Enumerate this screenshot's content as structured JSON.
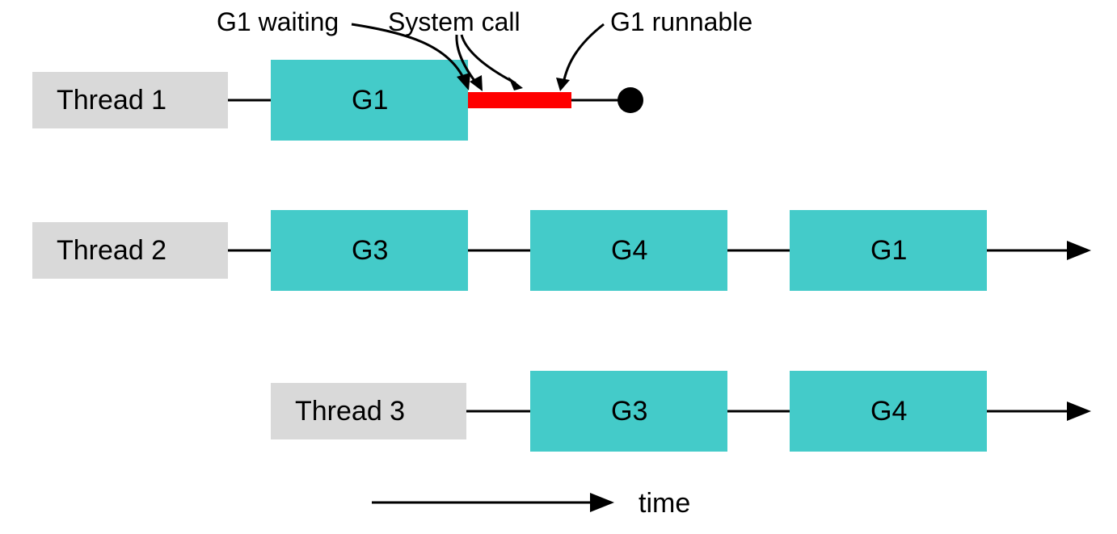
{
  "labels": {
    "g1_waiting": "G1 waiting",
    "system_call": "System call",
    "g1_runnable": "G1 runnable",
    "time": "time"
  },
  "threads": {
    "t1": {
      "label": "Thread 1",
      "boxes": [
        "G1"
      ]
    },
    "t2": {
      "label": "Thread 2",
      "boxes": [
        "G3",
        "G4",
        "G1"
      ]
    },
    "t3": {
      "label": "Thread 3",
      "boxes": [
        "G3",
        "G4"
      ]
    }
  },
  "colors": {
    "thread_box": "#d9d9d9",
    "goroutine_box": "#44cbc9",
    "syscall": "#ff0000",
    "line": "#000000"
  }
}
